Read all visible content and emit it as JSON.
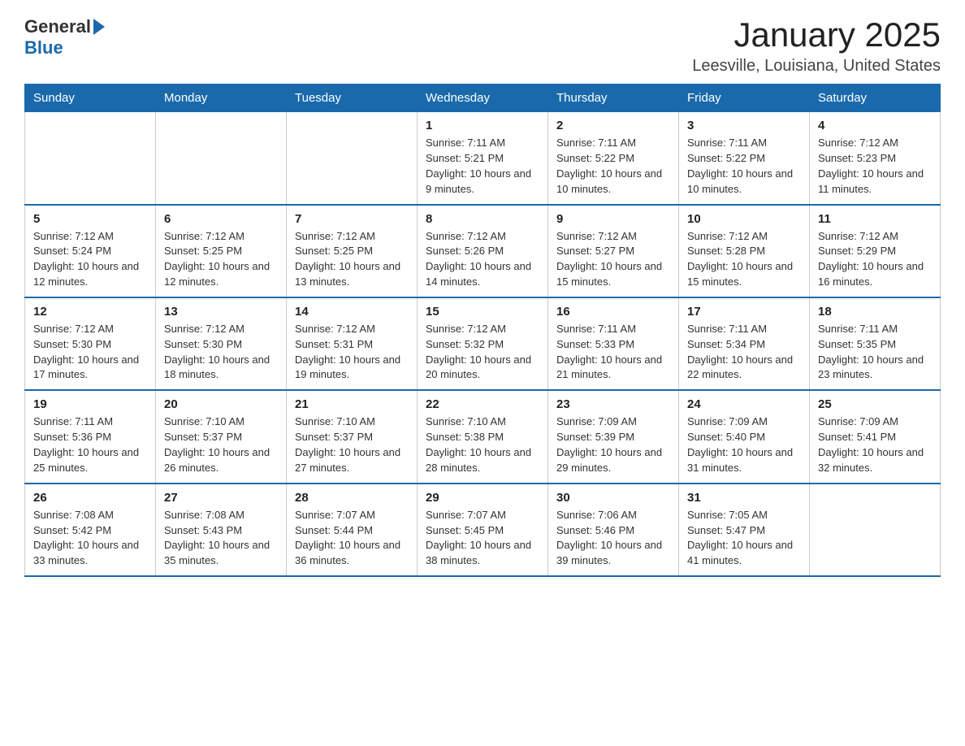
{
  "logo": {
    "text_general": "General",
    "text_blue": "Blue"
  },
  "header": {
    "title": "January 2025",
    "subtitle": "Leesville, Louisiana, United States"
  },
  "days_of_week": [
    "Sunday",
    "Monday",
    "Tuesday",
    "Wednesday",
    "Thursday",
    "Friday",
    "Saturday"
  ],
  "weeks": [
    [
      {
        "day": "",
        "info": ""
      },
      {
        "day": "",
        "info": ""
      },
      {
        "day": "",
        "info": ""
      },
      {
        "day": "1",
        "info": "Sunrise: 7:11 AM\nSunset: 5:21 PM\nDaylight: 10 hours and 9 minutes."
      },
      {
        "day": "2",
        "info": "Sunrise: 7:11 AM\nSunset: 5:22 PM\nDaylight: 10 hours and 10 minutes."
      },
      {
        "day": "3",
        "info": "Sunrise: 7:11 AM\nSunset: 5:22 PM\nDaylight: 10 hours and 10 minutes."
      },
      {
        "day": "4",
        "info": "Sunrise: 7:12 AM\nSunset: 5:23 PM\nDaylight: 10 hours and 11 minutes."
      }
    ],
    [
      {
        "day": "5",
        "info": "Sunrise: 7:12 AM\nSunset: 5:24 PM\nDaylight: 10 hours and 12 minutes."
      },
      {
        "day": "6",
        "info": "Sunrise: 7:12 AM\nSunset: 5:25 PM\nDaylight: 10 hours and 12 minutes."
      },
      {
        "day": "7",
        "info": "Sunrise: 7:12 AM\nSunset: 5:25 PM\nDaylight: 10 hours and 13 minutes."
      },
      {
        "day": "8",
        "info": "Sunrise: 7:12 AM\nSunset: 5:26 PM\nDaylight: 10 hours and 14 minutes."
      },
      {
        "day": "9",
        "info": "Sunrise: 7:12 AM\nSunset: 5:27 PM\nDaylight: 10 hours and 15 minutes."
      },
      {
        "day": "10",
        "info": "Sunrise: 7:12 AM\nSunset: 5:28 PM\nDaylight: 10 hours and 15 minutes."
      },
      {
        "day": "11",
        "info": "Sunrise: 7:12 AM\nSunset: 5:29 PM\nDaylight: 10 hours and 16 minutes."
      }
    ],
    [
      {
        "day": "12",
        "info": "Sunrise: 7:12 AM\nSunset: 5:30 PM\nDaylight: 10 hours and 17 minutes."
      },
      {
        "day": "13",
        "info": "Sunrise: 7:12 AM\nSunset: 5:30 PM\nDaylight: 10 hours and 18 minutes."
      },
      {
        "day": "14",
        "info": "Sunrise: 7:12 AM\nSunset: 5:31 PM\nDaylight: 10 hours and 19 minutes."
      },
      {
        "day": "15",
        "info": "Sunrise: 7:12 AM\nSunset: 5:32 PM\nDaylight: 10 hours and 20 minutes."
      },
      {
        "day": "16",
        "info": "Sunrise: 7:11 AM\nSunset: 5:33 PM\nDaylight: 10 hours and 21 minutes."
      },
      {
        "day": "17",
        "info": "Sunrise: 7:11 AM\nSunset: 5:34 PM\nDaylight: 10 hours and 22 minutes."
      },
      {
        "day": "18",
        "info": "Sunrise: 7:11 AM\nSunset: 5:35 PM\nDaylight: 10 hours and 23 minutes."
      }
    ],
    [
      {
        "day": "19",
        "info": "Sunrise: 7:11 AM\nSunset: 5:36 PM\nDaylight: 10 hours and 25 minutes."
      },
      {
        "day": "20",
        "info": "Sunrise: 7:10 AM\nSunset: 5:37 PM\nDaylight: 10 hours and 26 minutes."
      },
      {
        "day": "21",
        "info": "Sunrise: 7:10 AM\nSunset: 5:37 PM\nDaylight: 10 hours and 27 minutes."
      },
      {
        "day": "22",
        "info": "Sunrise: 7:10 AM\nSunset: 5:38 PM\nDaylight: 10 hours and 28 minutes."
      },
      {
        "day": "23",
        "info": "Sunrise: 7:09 AM\nSunset: 5:39 PM\nDaylight: 10 hours and 29 minutes."
      },
      {
        "day": "24",
        "info": "Sunrise: 7:09 AM\nSunset: 5:40 PM\nDaylight: 10 hours and 31 minutes."
      },
      {
        "day": "25",
        "info": "Sunrise: 7:09 AM\nSunset: 5:41 PM\nDaylight: 10 hours and 32 minutes."
      }
    ],
    [
      {
        "day": "26",
        "info": "Sunrise: 7:08 AM\nSunset: 5:42 PM\nDaylight: 10 hours and 33 minutes."
      },
      {
        "day": "27",
        "info": "Sunrise: 7:08 AM\nSunset: 5:43 PM\nDaylight: 10 hours and 35 minutes."
      },
      {
        "day": "28",
        "info": "Sunrise: 7:07 AM\nSunset: 5:44 PM\nDaylight: 10 hours and 36 minutes."
      },
      {
        "day": "29",
        "info": "Sunrise: 7:07 AM\nSunset: 5:45 PM\nDaylight: 10 hours and 38 minutes."
      },
      {
        "day": "30",
        "info": "Sunrise: 7:06 AM\nSunset: 5:46 PM\nDaylight: 10 hours and 39 minutes."
      },
      {
        "day": "31",
        "info": "Sunrise: 7:05 AM\nSunset: 5:47 PM\nDaylight: 10 hours and 41 minutes."
      },
      {
        "day": "",
        "info": ""
      }
    ]
  ]
}
